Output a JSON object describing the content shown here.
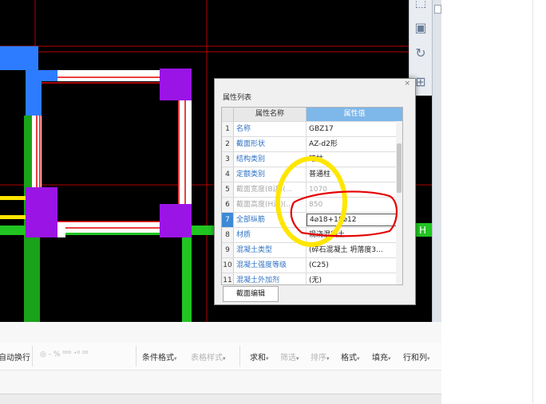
{
  "dialog": {
    "title": "属性列表",
    "close_glyph": "×",
    "headers": {
      "name": "属性名称",
      "value": "属性值"
    },
    "rows": [
      {
        "num": "1",
        "name": "名称",
        "value": "GBZ17"
      },
      {
        "num": "2",
        "name": "截面形状",
        "value": "AZ-d2形"
      },
      {
        "num": "3",
        "name": "结构类别",
        "value": "暗柱"
      },
      {
        "num": "4",
        "name": "定额类别",
        "value": "普通柱"
      },
      {
        "num": "5",
        "name": "截面宽度(B边)(...",
        "value": "1070"
      },
      {
        "num": "6",
        "name": "截面高度(H边)(...",
        "value": "850"
      },
      {
        "num": "7",
        "name": "全部纵筋",
        "value": "4⌀18+18⌀12"
      },
      {
        "num": "8",
        "name": "材质",
        "value": "现浇混凝土"
      },
      {
        "num": "9",
        "name": "混凝土类型",
        "value": "(碎石混凝土 坍落度3..."
      },
      {
        "num": "10",
        "name": "混凝土强度等级",
        "value": "(C25)"
      },
      {
        "num": "11",
        "name": "混凝土外加剂",
        "value": "(无)"
      }
    ],
    "edit_button": "截面编辑"
  },
  "cad": {
    "axis_label": "H"
  },
  "right_toolbar": {
    "button_glyphs": [
      "⬚",
      "▣",
      "↻",
      "⊞"
    ]
  },
  "ribbon": {
    "wrap_text": "自动换行",
    "percent_group": "◎ - % ⁰⁰⁰ ⁺⁰ ⁰⁰",
    "items": [
      {
        "label": "条件格式",
        "disabled": false
      },
      {
        "label": "表格样式",
        "disabled": true
      },
      {
        "label": "求和",
        "disabled": false
      },
      {
        "label": "筛选",
        "disabled": true
      },
      {
        "label": "排序",
        "disabled": true
      },
      {
        "label": "格式",
        "disabled": false
      },
      {
        "label": "填充",
        "disabled": false
      },
      {
        "label": "行和列",
        "disabled": false
      }
    ]
  },
  "colors": {
    "wall_white": "#ffffff",
    "rebar_red": "#e00000",
    "column_purple": "#9b14e6",
    "column_blue": "#2d7cff",
    "beam_green": "#22c422",
    "grid_red": "#b40000",
    "annot_yellow": "#ffe600",
    "annot_red": "#e60000"
  }
}
